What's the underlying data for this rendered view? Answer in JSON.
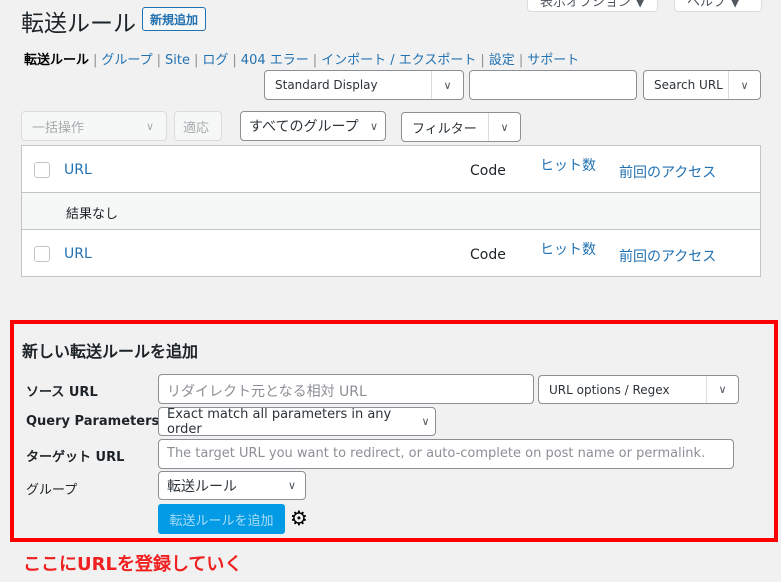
{
  "header": {
    "title": "転送ルール",
    "new_button": "新規追加",
    "screen_options": "表示オプション ▼",
    "help": "ヘルプ ▼"
  },
  "subnav": [
    {
      "label": "転送ルール",
      "current": true
    },
    {
      "label": "グループ"
    },
    {
      "label": "Site"
    },
    {
      "label": "ログ"
    },
    {
      "label": "404 エラー"
    },
    {
      "label": "インポート / エクスポート"
    },
    {
      "label": "設定"
    },
    {
      "label": "サポート"
    }
  ],
  "toolbar": {
    "display_select": "Standard Display",
    "search_value": "",
    "search_button": "Search URL",
    "bulk_action": "一括操作",
    "apply": "適応",
    "group_filter": "すべてのグループ",
    "filter": "フィルター"
  },
  "table": {
    "columns": {
      "url": "URL",
      "code": "Code",
      "hits": "ヒット数",
      "last_access": "前回のアクセス"
    },
    "empty": "結果なし"
  },
  "form": {
    "heading": "新しい転送ルールを追加",
    "source_label": "ソース URL",
    "source_placeholder": "リダイレクト元となる相対 URL",
    "url_options": "URL options / Regex",
    "query_label": "Query Parameters",
    "query_value": "Exact match all parameters in any order",
    "target_label": "ターゲット URL",
    "target_placeholder": "The target URL you want to redirect, or auto-complete on post name or permalink.",
    "group_label": "グループ",
    "group_value": "転送ルール",
    "submit": "転送ルールを追加"
  },
  "annotation": "ここにURLを登録していく",
  "colors": {
    "accent": "#2271b1",
    "highlight": "#ff0000",
    "submit_bg": "#039be5"
  }
}
